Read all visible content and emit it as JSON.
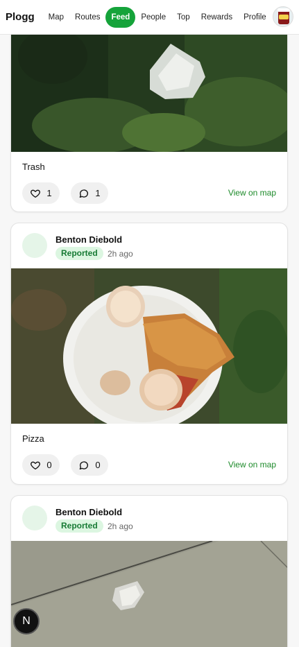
{
  "app": {
    "brand": "Plogg"
  },
  "nav": [
    {
      "label": "Map",
      "active": false
    },
    {
      "label": "Routes",
      "active": false
    },
    {
      "label": "Feed",
      "active": true
    },
    {
      "label": "People",
      "active": false
    },
    {
      "label": "Top",
      "active": false
    },
    {
      "label": "Rewards",
      "active": false
    },
    {
      "label": "Profile",
      "active": false
    }
  ],
  "posts": [
    {
      "caption": "Trash",
      "likes": "1",
      "comments": "1",
      "map_link": "View on map"
    },
    {
      "user": "Benton Diebold",
      "status": "Reported",
      "time": "2h ago",
      "caption": "Pizza",
      "likes": "0",
      "comments": "0",
      "map_link": "View on map"
    },
    {
      "user": "Benton Diebold",
      "status": "Reported",
      "time": "2h ago"
    }
  ],
  "dev_badge": {
    "letter": "N"
  },
  "colors": {
    "accent": "#15a33a",
    "badge_bg": "#dcf6e1",
    "badge_text": "#167a34",
    "link": "#1d8a2a"
  }
}
